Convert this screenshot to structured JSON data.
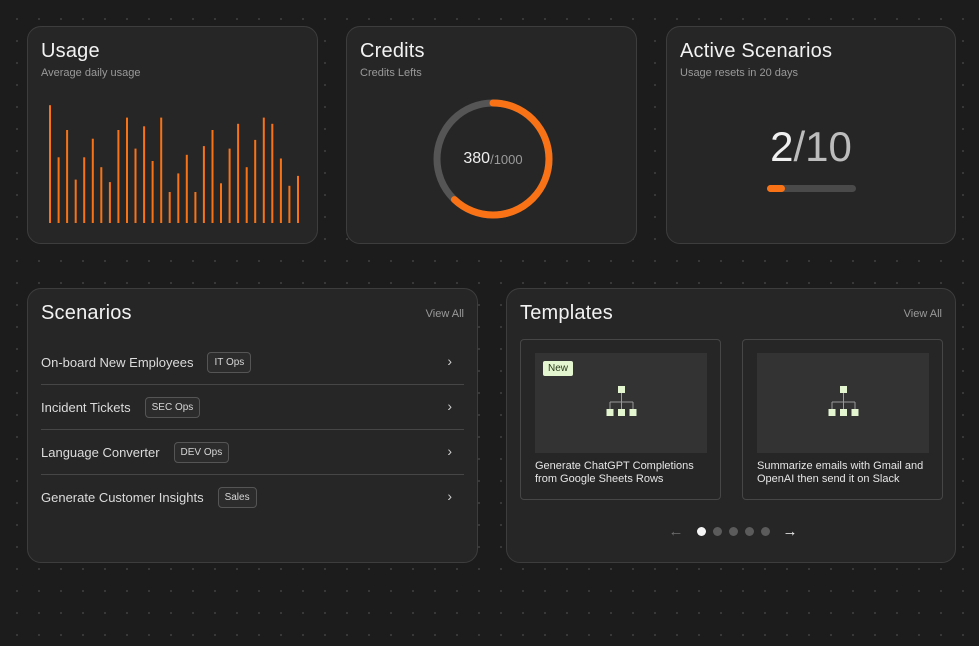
{
  "usage": {
    "title": "Usage",
    "subtitle": "Average daily usage",
    "bar_color": "#f97316",
    "daily_values": [
      95,
      53,
      75,
      35,
      53,
      68,
      45,
      33,
      75,
      85,
      60,
      78,
      50,
      85,
      25,
      40,
      55,
      25,
      62,
      75,
      32,
      60,
      80,
      45,
      67,
      85,
      80,
      52,
      30,
      38
    ]
  },
  "credits": {
    "title": "Credits",
    "subtitle": "Credits Lefts",
    "used": "380",
    "total": "/1000",
    "used_value": 380,
    "total_value": 1000,
    "ring_color": "#f97316",
    "track_color": "#555555"
  },
  "active": {
    "title": "Active Scenarios",
    "subtitle": "Usage resets in 20 days",
    "count": "2",
    "slash": "/",
    "max": "10",
    "progress_fraction": 0.2,
    "accent": "#f97316"
  },
  "scenarios": {
    "title": "Scenarios",
    "view_all": "View All",
    "items": [
      {
        "name": "On-board New Employees",
        "tag": "IT Ops"
      },
      {
        "name": "Incident Tickets",
        "tag": "SEC Ops"
      },
      {
        "name": "Language Converter",
        "tag": "DEV Ops"
      },
      {
        "name": "Generate Customer Insights",
        "tag": "Sales"
      }
    ],
    "chevron_icon": "chevron-right-icon",
    "chevron_glyph": "›"
  },
  "templates": {
    "title": "Templates",
    "view_all": "View All",
    "items": [
      {
        "badge": "New",
        "title": "Generate ChatGPT Completions from Google Sheets Rows",
        "icon": "workflow-tree-icon"
      },
      {
        "badge": "",
        "title": "Summarize emails with Gmail and OpenAI then send it on Slack",
        "icon": "workflow-tree-icon"
      }
    ],
    "pager": {
      "prev": "←",
      "next": "→",
      "pages": 5,
      "active_page": 1
    },
    "node_color": "#e3f6d0"
  }
}
